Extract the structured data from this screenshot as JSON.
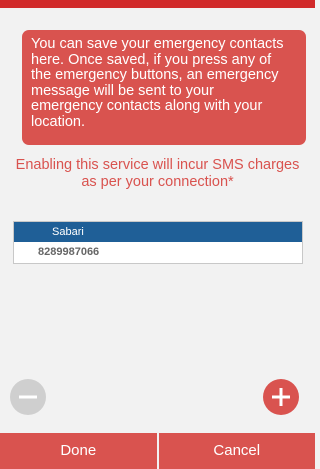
{
  "info_box": {
    "lines": [
      "You can save your emergency contacts",
      "here. Once saved, if you press any of",
      "the emergency buttons, an emergency",
      "message will be sent to your",
      "emergency contacts along with your",
      "location."
    ]
  },
  "notice": {
    "lines": [
      "Enabling this service will incur SMS charges",
      "as per your connection*"
    ]
  },
  "contacts": [
    {
      "name": "Sabari",
      "number": "8289987066"
    }
  ],
  "buttons": {
    "remove_icon": "minus-icon",
    "add_icon": "plus-icon",
    "done_label": "Done",
    "cancel_label": "Cancel"
  },
  "colors": {
    "accent": "#d9534f",
    "top_strip": "#d12a2a",
    "contact_header": "#1f5f97",
    "remove_button": "#cfcfcf"
  }
}
